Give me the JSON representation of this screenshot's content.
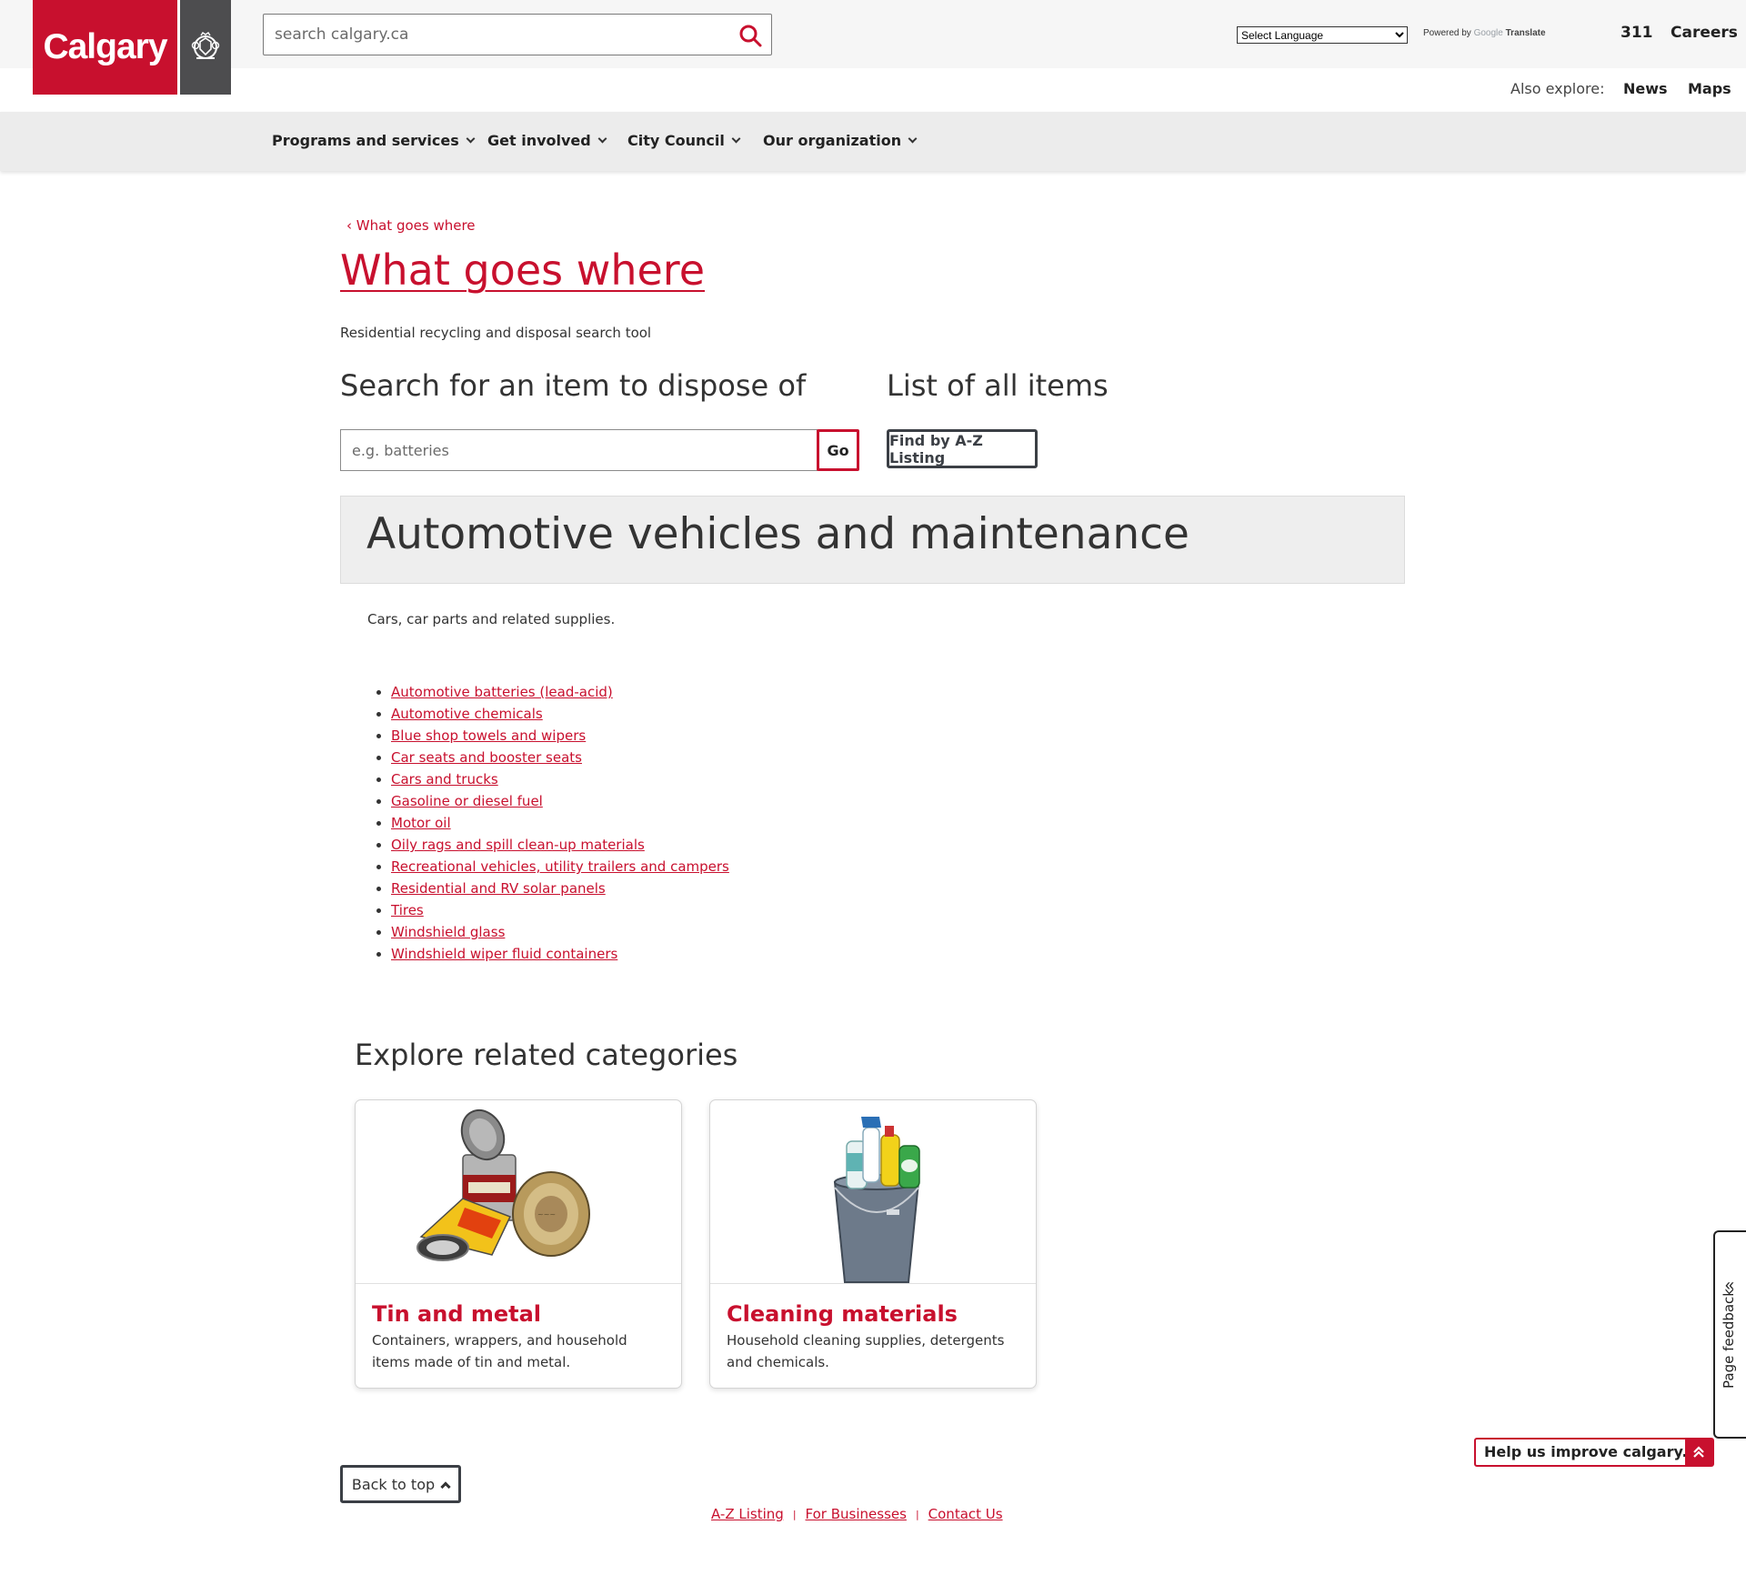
{
  "brand": {
    "name": "Calgary",
    "crest": "city-crest-icon",
    "primary_color": "#c8102e",
    "dark_color": "#4d4d4f"
  },
  "header": {
    "search_placeholder": "search calgary.ca",
    "language_select": "Select Language",
    "powered_by": "Powered by",
    "google": "Google",
    "translate": "Translate",
    "util_links": [
      "311",
      "Careers"
    ],
    "also_explore_label": "Also explore:",
    "also_explore_links": [
      "News",
      "Maps"
    ]
  },
  "nav": [
    "Programs and services",
    "Get involved",
    "City Council",
    "Our organization"
  ],
  "breadcrumb": "What goes where",
  "page": {
    "title": "What goes where",
    "subtitle": "Residential recycling and disposal search tool",
    "search_heading": "Search for an item to dispose of",
    "search_placeholder": "e.g. batteries",
    "go_label": "Go",
    "list_heading": "List of all items",
    "az_label": "Find by A-Z Listing"
  },
  "category": {
    "title": "Automotive vehicles and maintenance",
    "description": "Cars, car parts and related supplies.",
    "items": [
      "Automotive batteries (lead-acid)",
      "Automotive chemicals",
      "Blue shop towels and wipers",
      "Car seats and booster seats",
      "Cars and trucks",
      "Gasoline or diesel fuel",
      "Motor oil",
      "Oily rags and spill clean-up materials",
      "Recreational vehicles, utility trailers and campers",
      "Residential and RV solar panels",
      "Tires",
      "Windshield glass",
      "Windshield wiper fluid containers"
    ]
  },
  "related": {
    "heading": "Explore related categories",
    "cards": [
      {
        "title": "Tin and metal",
        "text": "Containers, wrappers, and household items made of tin and metal."
      },
      {
        "title": "Cleaning materials",
        "text": "Household cleaning supplies, detergents and chemicals."
      }
    ]
  },
  "footer": {
    "back_to_top": "Back to top",
    "links": [
      "A-Z Listing",
      "For Businesses",
      "Contact Us"
    ]
  },
  "feedback": {
    "tab_label": "Page feedback",
    "help_label": "Help us improve calgary.ca"
  }
}
